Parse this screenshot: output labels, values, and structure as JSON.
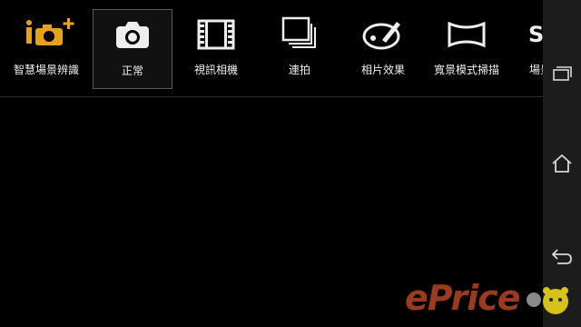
{
  "modes": [
    {
      "label": "智慧場景辨識",
      "icon": "intelligent-auto-icon",
      "selected": false
    },
    {
      "label": "正常",
      "icon": "camera-icon",
      "selected": true
    },
    {
      "label": "視訊相機",
      "icon": "film-icon",
      "selected": false
    },
    {
      "label": "連拍",
      "icon": "burst-icon",
      "selected": false
    },
    {
      "label": "相片效果",
      "icon": "palette-icon",
      "selected": false
    },
    {
      "label": "寬景模式掃描",
      "icon": "panorama-icon",
      "selected": false
    },
    {
      "label": "場景",
      "icon": "scene-icon",
      "selected": false
    }
  ],
  "partial_icon_text": "SC",
  "watermark": {
    "text": "ePrice"
  },
  "colors": {
    "accent": "#e8a21a",
    "background": "#000000",
    "navbar": "#1c1c1c"
  }
}
